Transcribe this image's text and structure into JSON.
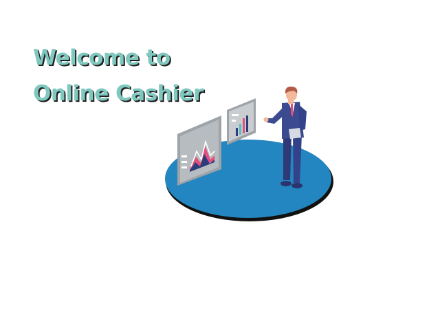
{
  "hero": {
    "title_line1": "Welcome to",
    "title_line2": "Online Cashier"
  },
  "illustration": {
    "name": "businessman-presenting-dashboard",
    "colors": {
      "platform": "#2386c0",
      "platform_shadow": "#111111",
      "panel": "#9da3a8",
      "chart_pink": "#e34f7c",
      "chart_navy": "#2d3c7a",
      "chart_teal": "#4fc0c7",
      "suit": "#3c4b8f",
      "hair": "#b35a45"
    }
  }
}
